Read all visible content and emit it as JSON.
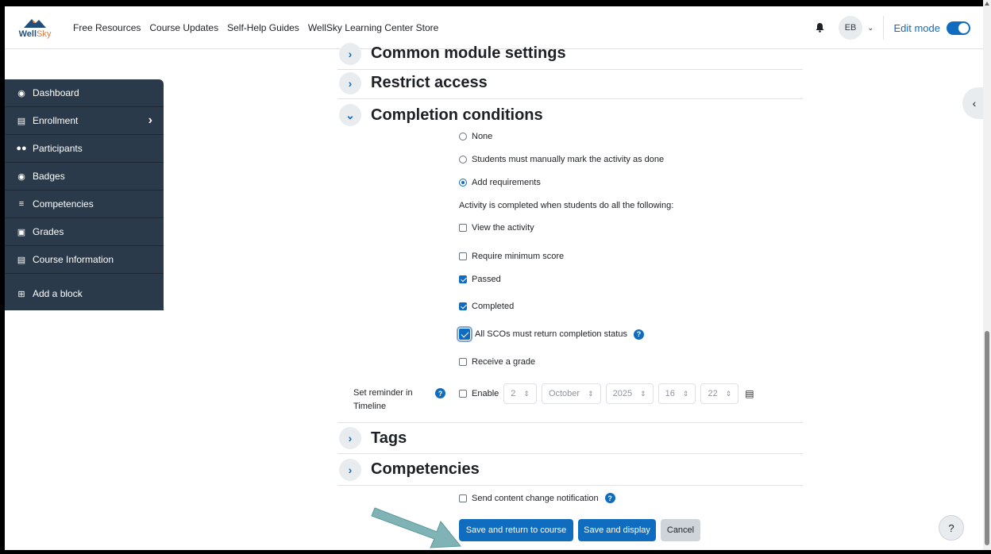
{
  "navbar": {
    "logo_main": "Well",
    "logo_accent": "Sky",
    "links": [
      "Free Resources",
      "Course Updates",
      "Self-Help Guides",
      "WellSky Learning Center Store"
    ],
    "avatar_initials": "EB",
    "edit_mode_label": "Edit mode"
  },
  "sidebar": {
    "items": [
      {
        "label": "Dashboard",
        "icon": "dashboard-icon"
      },
      {
        "label": "Enrollment",
        "icon": "institution-icon"
      },
      {
        "label": "Participants",
        "icon": "users-icon"
      },
      {
        "label": "Badges",
        "icon": "badge-icon"
      },
      {
        "label": "Competencies",
        "icon": "list-icon"
      },
      {
        "label": "Grades",
        "icon": "clipboard-icon"
      },
      {
        "label": "Course Information",
        "icon": "list-alt-icon"
      },
      {
        "label": "Add a block",
        "icon": "plus-square-icon"
      }
    ]
  },
  "sections": {
    "common_module": "Common module settings",
    "restrict_access": "Restrict access",
    "completion_conditions": "Completion conditions",
    "tags": "Tags",
    "competencies": "Competencies"
  },
  "completion": {
    "options": [
      {
        "label": "None",
        "selected": false
      },
      {
        "label": "Students must manually mark the activity as done",
        "selected": false
      },
      {
        "label": "Add requirements",
        "selected": true
      }
    ],
    "requirements_intro": "Activity is completed when students do all the following:",
    "requirements": [
      {
        "label": "View the activity",
        "checked": false
      },
      {
        "label": "Require minimum score",
        "checked": false
      },
      {
        "label": "Passed",
        "checked": true
      },
      {
        "label": "Completed",
        "checked": true
      },
      {
        "label": "All SCOs must return completion status",
        "checked": true
      },
      {
        "label": "Receive a grade",
        "checked": false
      }
    ]
  },
  "reminder": {
    "label": "Set reminder in Timeline",
    "enable_label": "Enable",
    "day": "2",
    "month": "October",
    "year": "2025",
    "hour": "16",
    "minute": "22"
  },
  "notification": {
    "label": "Send content change notification"
  },
  "buttons": {
    "save_return": "Save and return to course",
    "save_display": "Save and display",
    "cancel": "Cancel"
  },
  "help_fab": "?",
  "colors": {
    "primary": "#0f6cbf",
    "sidebar": "#2b3a4a",
    "annotation_arrow": "#7fb3b5"
  }
}
